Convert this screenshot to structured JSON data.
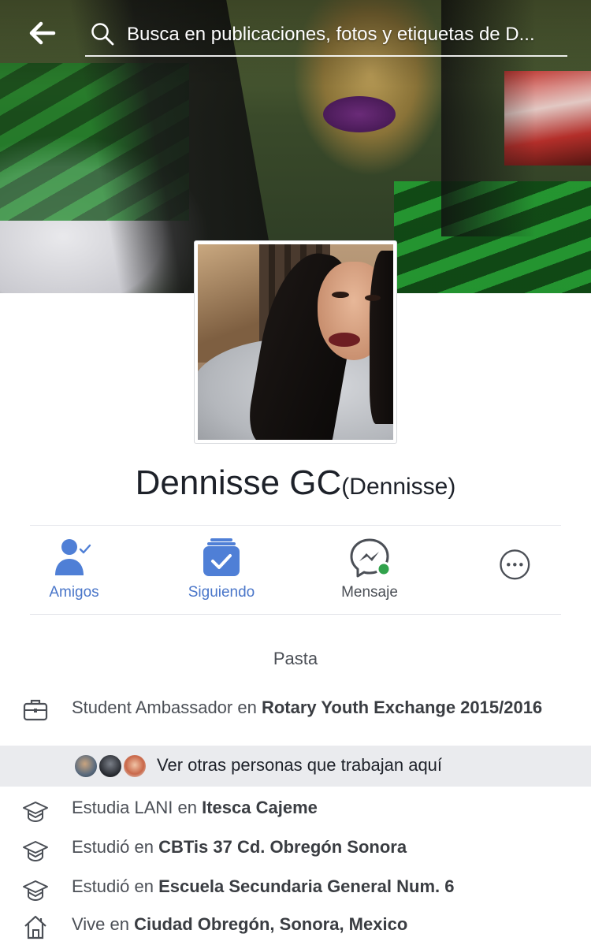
{
  "header": {
    "search_placeholder": "Busca en publicaciones, fotos y etiquetas de D..."
  },
  "profile": {
    "name": "Dennisse GC",
    "nickname": "(Dennisse)"
  },
  "actions": [
    {
      "label": "Amigos"
    },
    {
      "label": "Siguiendo"
    },
    {
      "label": "Mensaje"
    }
  ],
  "about": {
    "section_title": "Pasta",
    "work": {
      "prefix": "Student Ambassador en ",
      "place": "Rotary Youth Exchange 2015/2016"
    },
    "coworkers_link": "Ver otras personas que trabajan aquí",
    "education": [
      {
        "prefix": "Estudia LANI en ",
        "place": "Itesca Cajeme"
      },
      {
        "prefix": "Estudió en ",
        "place": "CBTis 37 Cd. Obregón Sonora"
      },
      {
        "prefix": "Estudió en ",
        "place": "Escuela Secundaria General Num. 6"
      }
    ],
    "lives": {
      "prefix": "Vive en ",
      "place": "Ciudad Obregón, Sonora, Mexico"
    }
  },
  "colors": {
    "accent_blue": "#4a76c9",
    "icon_blue": "#4f7fd6",
    "online_green": "#31a24c",
    "text_gray": "#4b4f56"
  }
}
